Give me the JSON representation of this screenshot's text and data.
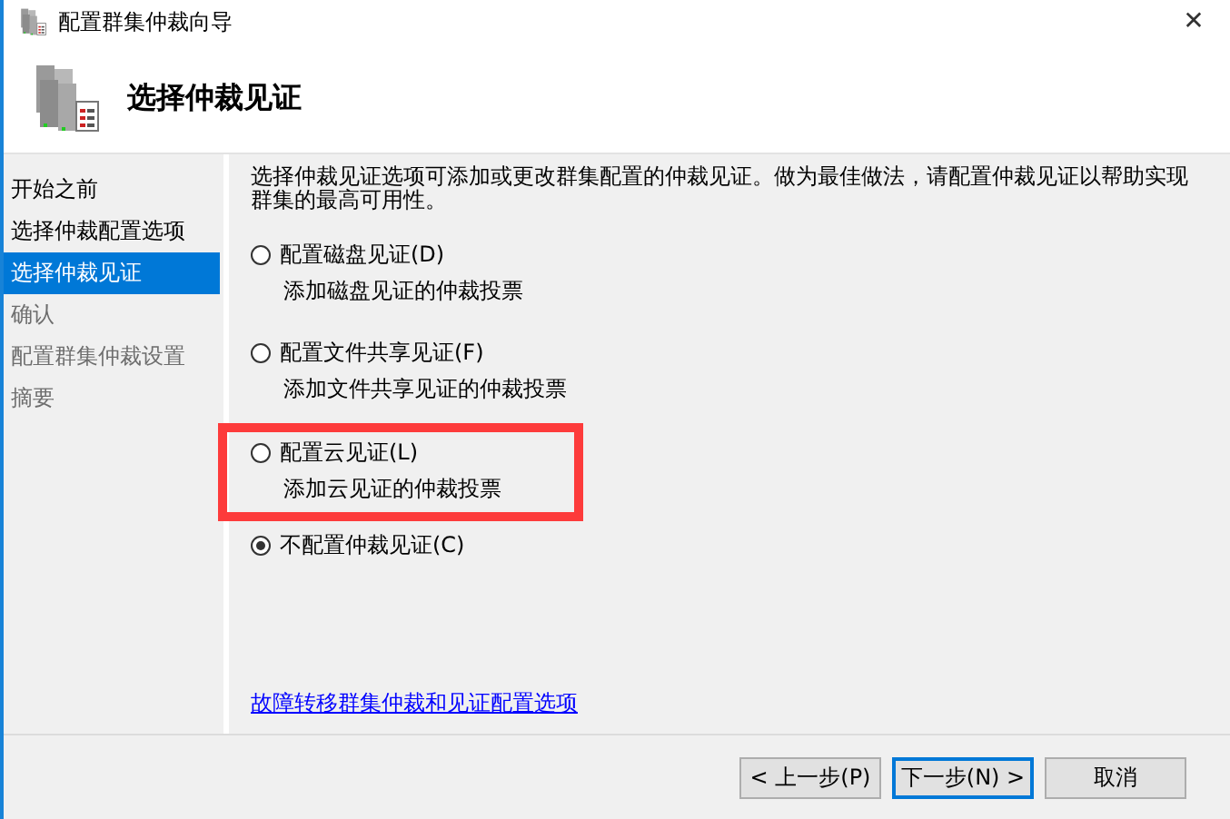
{
  "window": {
    "title": "配置群集仲裁向导",
    "close": "✕"
  },
  "header": {
    "title": "选择仲裁见证"
  },
  "steps": [
    {
      "label": "开始之前",
      "selected": false,
      "disabled": false
    },
    {
      "label": "选择仲裁配置选项",
      "selected": false,
      "disabled": false
    },
    {
      "label": "选择仲裁见证",
      "selected": true,
      "disabled": false
    },
    {
      "label": "确认",
      "selected": false,
      "disabled": true
    },
    {
      "label": "配置群集仲裁设置",
      "selected": false,
      "disabled": true
    },
    {
      "label": "摘要",
      "selected": false,
      "disabled": true
    }
  ],
  "intro": "选择仲裁见证选项可添加或更改群集配置的仲裁见证。做为最佳做法，请配置仲裁见证以帮助实现群集的最高可用性。",
  "options": [
    {
      "label": "配置磁盘见证(D)",
      "description": "添加磁盘见证的仲裁投票",
      "selected": false,
      "highlighted": false
    },
    {
      "label": "配置文件共享见证(F)",
      "description": "添加文件共享见证的仲裁投票",
      "selected": false,
      "highlighted": false
    },
    {
      "label": "配置云见证(L)",
      "description": "添加云见证的仲裁投票",
      "selected": false,
      "highlighted": true
    },
    {
      "label": "不配置仲裁见证(C)",
      "selected": true,
      "highlighted": false
    }
  ],
  "link": "故障转移群集仲裁和见证配置选项",
  "buttons": [
    {
      "label": "< 上一步(P)",
      "default": false
    },
    {
      "label": "下一步(N) >",
      "default": true
    },
    {
      "label": "取消",
      "default": false
    }
  ]
}
